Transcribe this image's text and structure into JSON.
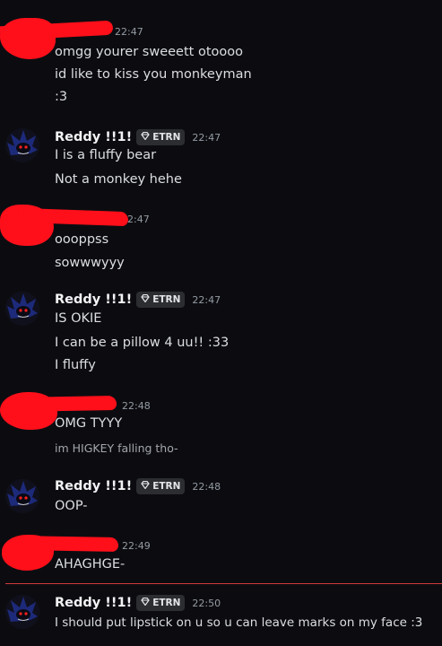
{
  "messages": [
    {
      "author": "",
      "time": "22:47",
      "lines": [
        "omgg yourer sweeett otoooo",
        "id like to kiss you monkeyman",
        ":3"
      ]
    },
    {
      "author": "Reddy !!1!",
      "tag": "ETRN",
      "time": "22:47",
      "lines": [
        "I is a fluffy bear",
        "Not a monkey hehe"
      ]
    },
    {
      "author": "",
      "time": "2:47",
      "lines": [
        "oooppss",
        "sowwwyyy"
      ]
    },
    {
      "author": "Reddy !!1!",
      "tag": "ETRN",
      "time": "22:47",
      "lines": [
        "IS OKIE",
        "I can be a pillow 4 uu!! :33",
        "I fluffy"
      ]
    },
    {
      "author": "",
      "time": "22:48",
      "lines": [
        "OMG TYYY",
        "im HIGKEY falling tho-"
      ]
    },
    {
      "author": "Reddy !!1!",
      "tag": "ETRN",
      "time": "22:48",
      "lines": [
        "OOP-"
      ]
    },
    {
      "author": "",
      "time": "22:49",
      "lines": [
        "AHAGHGE-"
      ]
    },
    {
      "author": "Reddy !!1!",
      "tag": "ETRN",
      "time": "22:50",
      "lines": [
        "I should put lipstick on u so u can leave marks on my face :3"
      ]
    }
  ],
  "colors": {
    "background": "#0c0c10",
    "redaction": "#ff0f1a",
    "new_messages_divider": "#d33a3a"
  },
  "icons": {
    "tag_badge": "gem-icon"
  }
}
